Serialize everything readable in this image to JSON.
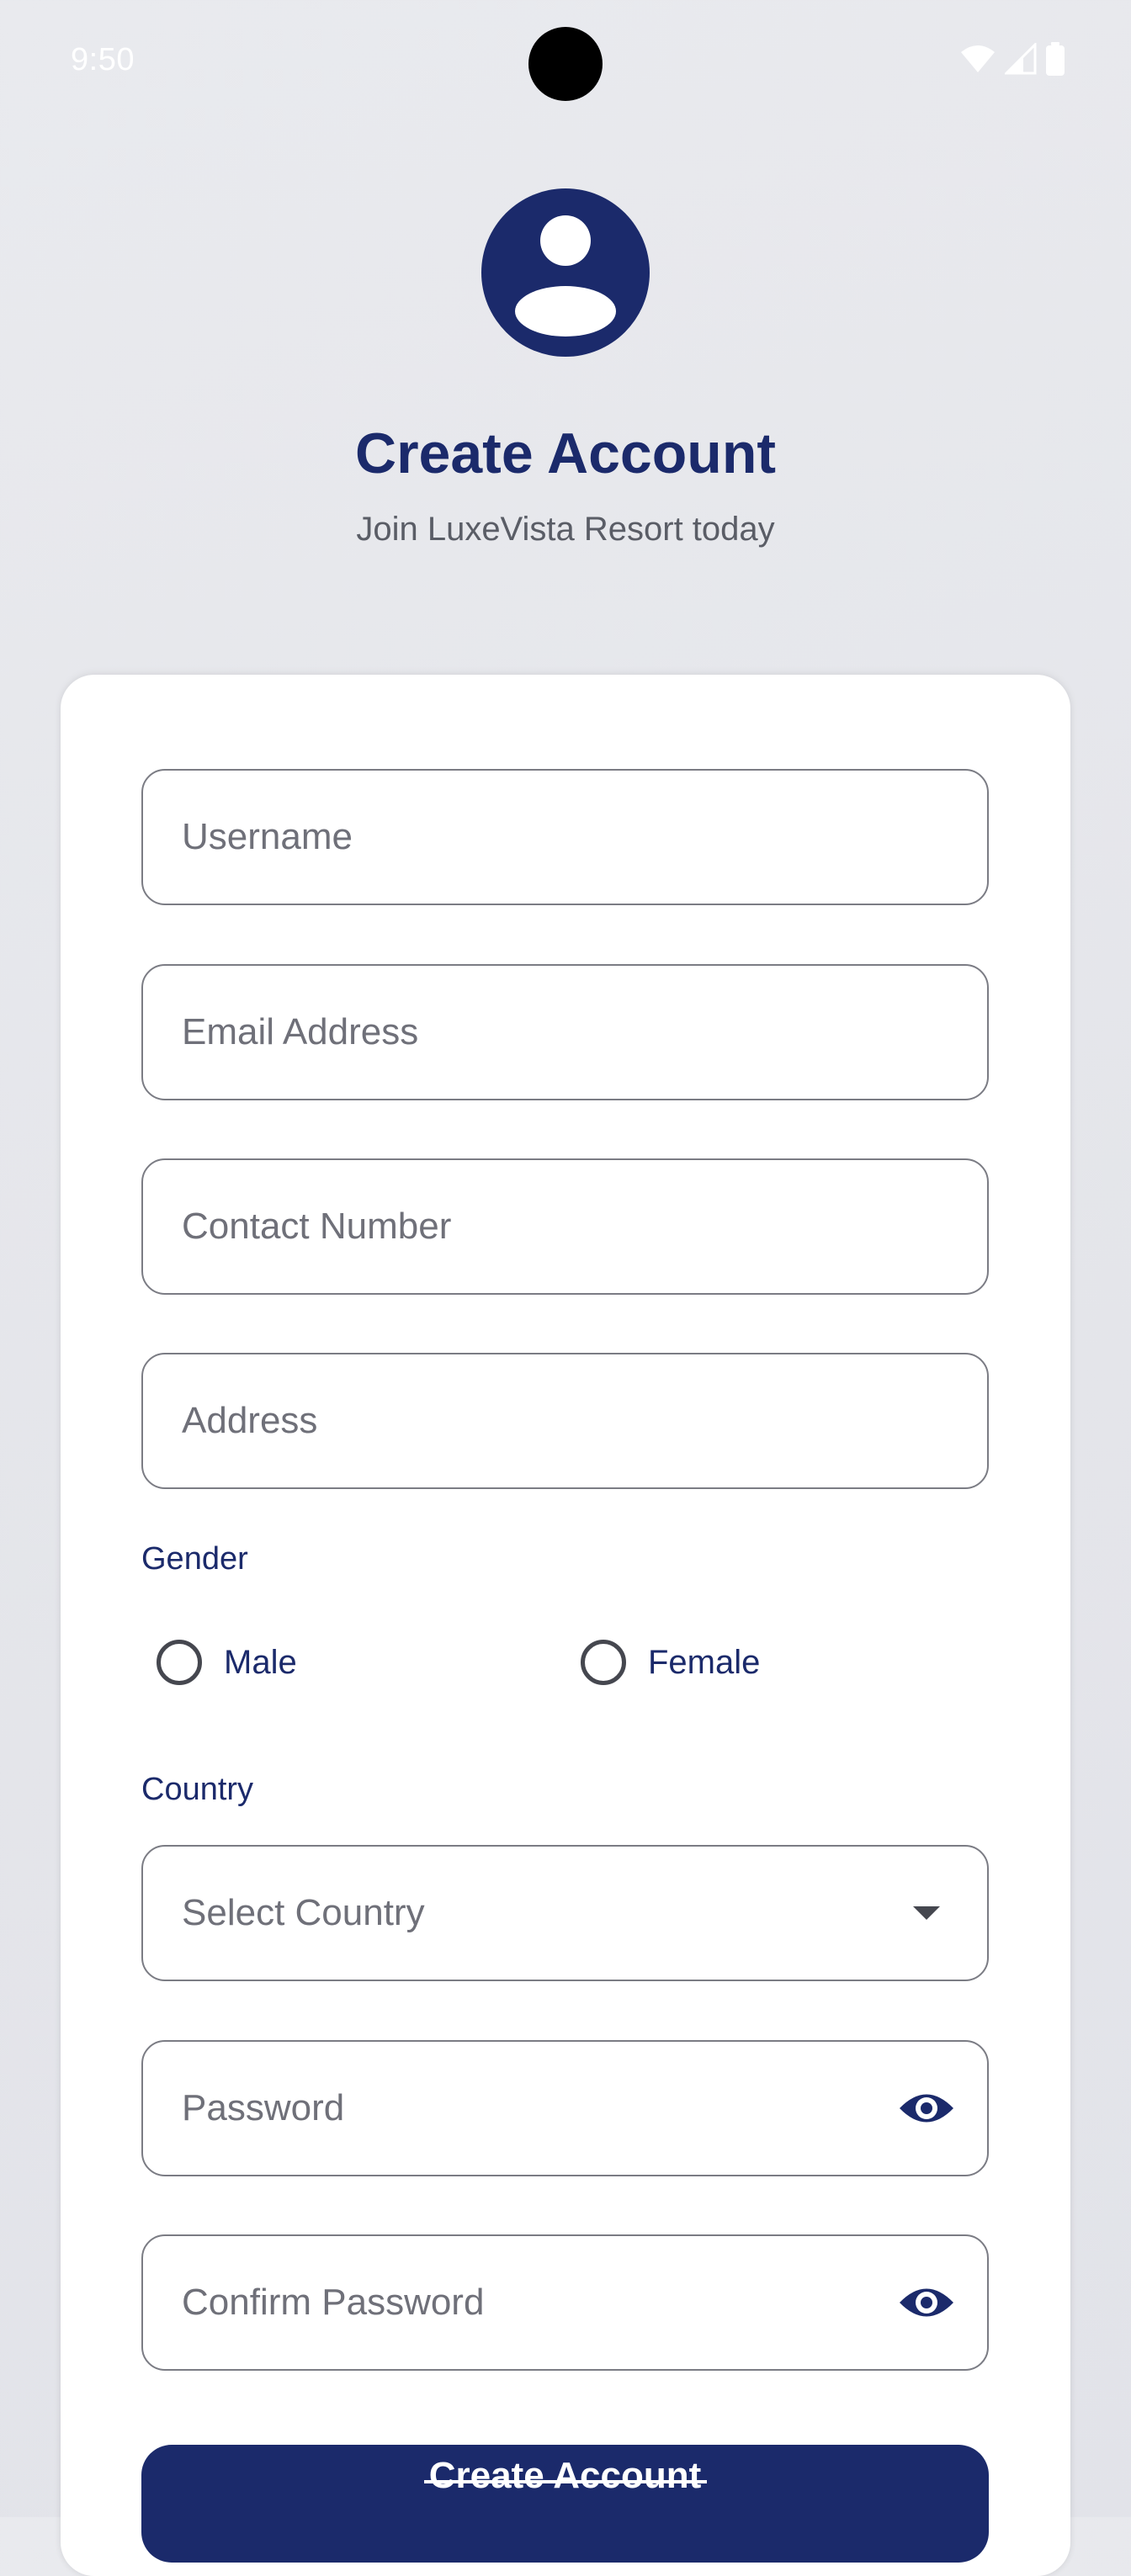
{
  "status_bar": {
    "time": "9:50",
    "icons": [
      "wifi-icon",
      "cellular-signal-icon",
      "battery-icon"
    ]
  },
  "header": {
    "avatar_icon": "account-circle-icon",
    "title": "Create Account",
    "subtitle": "Join LuxeVista Resort today"
  },
  "form": {
    "username": {
      "placeholder": "Username",
      "value": ""
    },
    "email": {
      "placeholder": "Email Address",
      "value": ""
    },
    "contact": {
      "placeholder": "Contact Number",
      "value": ""
    },
    "address": {
      "placeholder": "Address",
      "value": ""
    },
    "gender": {
      "label": "Gender",
      "options": [
        {
          "label": "Male",
          "selected": false
        },
        {
          "label": "Female",
          "selected": false
        }
      ]
    },
    "country": {
      "label": "Country",
      "selected": "Select Country",
      "icon": "dropdown-arrow-icon"
    },
    "password": {
      "placeholder": "Password",
      "value": "",
      "icon": "eye-icon"
    },
    "confirm_password": {
      "placeholder": "Confirm Password",
      "value": "",
      "icon": "eye-icon"
    },
    "submit_label": "Create Account"
  },
  "colors": {
    "primary": "#1b2a6b",
    "background": "#e6e7ec",
    "card": "#ffffff",
    "outline": "#7b7c84",
    "placeholder": "#6f7079"
  }
}
